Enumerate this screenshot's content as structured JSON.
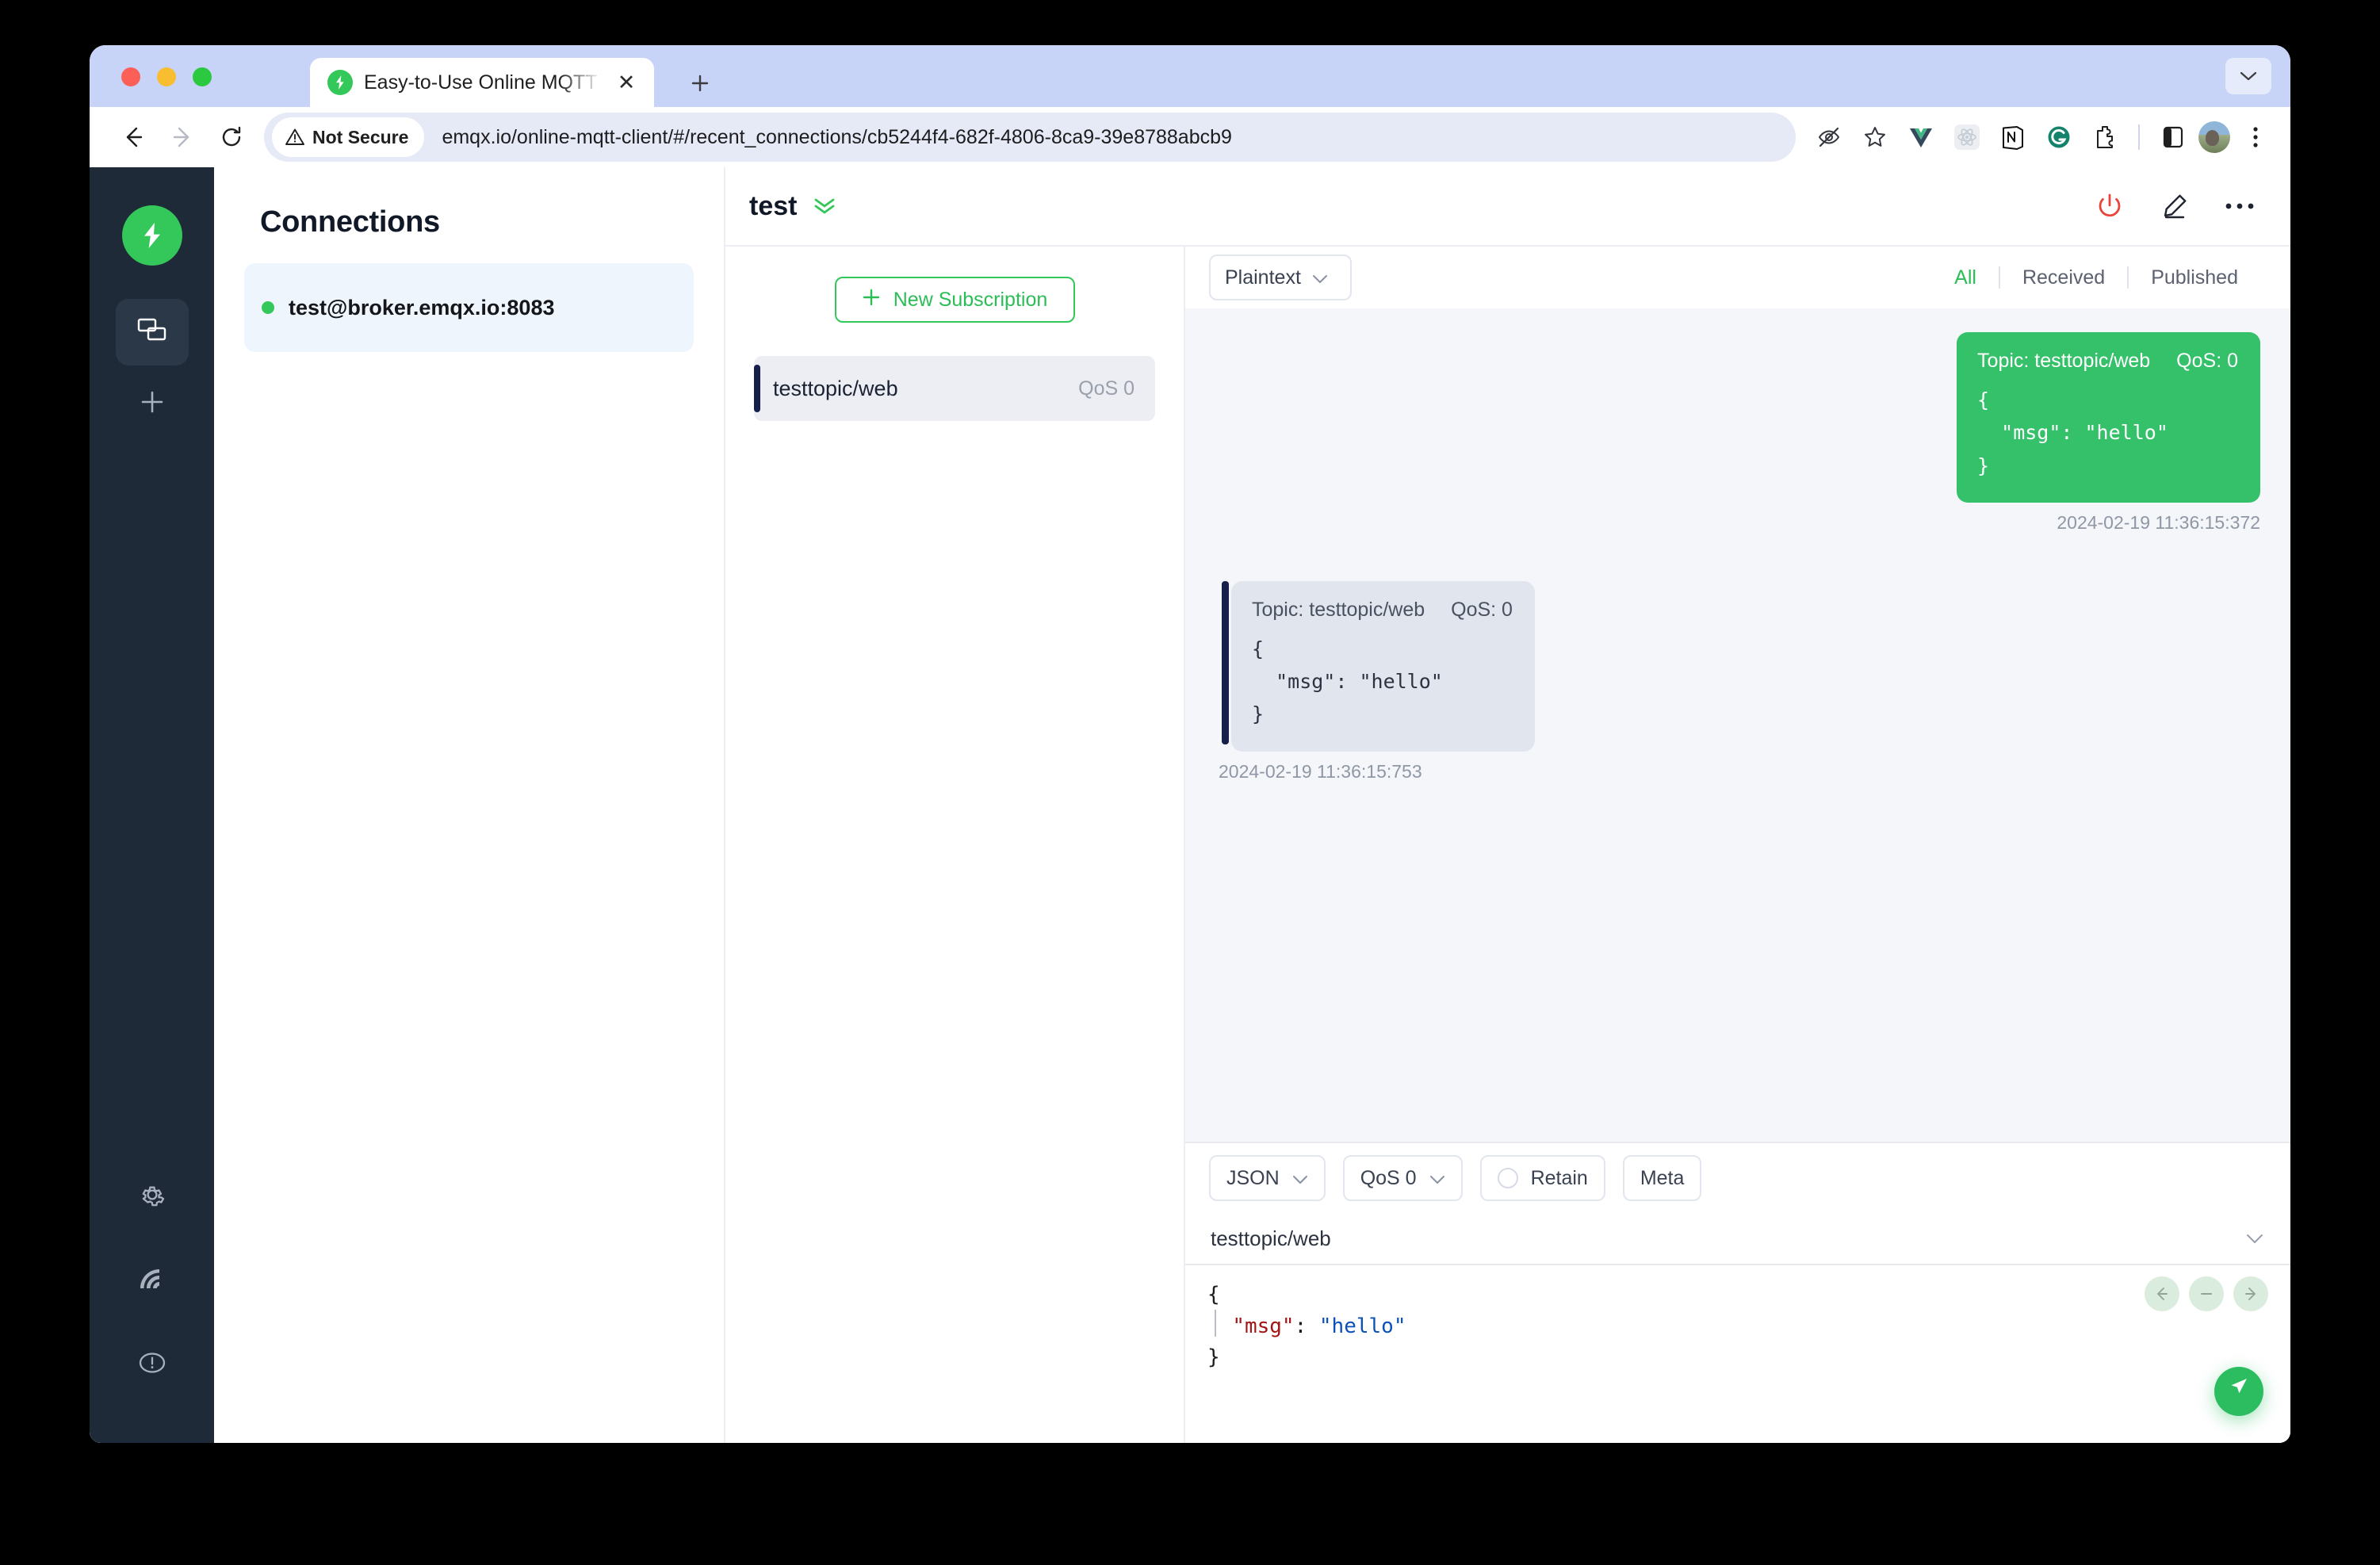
{
  "browser": {
    "tab": {
      "title": "Easy-to-Use Online MQTT Cli",
      "favicon_icon": "emqx-logo-icon",
      "close_icon": "close-icon"
    },
    "new_tab_icon": "plus-icon",
    "tab_list_icon": "chevron-down-icon",
    "nav": {
      "back_icon": "back-arrow-icon",
      "forward_icon": "forward-arrow-icon",
      "reload_icon": "reload-icon"
    },
    "omnibox": {
      "security_label": "Not Secure",
      "security_icon": "warning-triangle-icon",
      "url": "emqx.io/online-mqtt-client/#/recent_connections/cb5244f4-682f-4806-8ca9-39e8788abcb9"
    },
    "toolbar_icons": [
      "eye-off-icon",
      "bookmark-star-icon",
      "vue-devtools-icon",
      "react-devtools-icon",
      "notion-icon",
      "grammarly-icon",
      "extensions-puzzle-icon",
      "side-panel-icon"
    ],
    "avatar_icon": "profile-avatar",
    "menu_icon": "three-dot-menu-icon"
  },
  "rail": {
    "logo_icon": "emqx-logo-icon",
    "items": [
      {
        "name": "connections",
        "icon": "windows-stack-icon",
        "active": true
      },
      {
        "name": "new-connection",
        "icon": "plus-icon",
        "active": false
      }
    ],
    "bottom_items": [
      {
        "name": "settings",
        "icon": "gear-icon"
      },
      {
        "name": "broadcast",
        "icon": "signal-waves-icon"
      },
      {
        "name": "about",
        "icon": "info-circle-icon"
      }
    ]
  },
  "connections": {
    "title": "Connections",
    "items": [
      {
        "label": "test@broker.emqx.io:8083",
        "status": "connected"
      }
    ]
  },
  "header": {
    "connection_name": "test",
    "expand_icon": "double-chevron-down-icon",
    "actions": [
      {
        "name": "disconnect",
        "icon": "power-icon"
      },
      {
        "name": "edit",
        "icon": "pencil-icon"
      },
      {
        "name": "more",
        "icon": "three-dot-menu-icon"
      }
    ]
  },
  "subscriptions": {
    "new_button_label": "New Subscription",
    "new_button_icon": "plus-icon",
    "items": [
      {
        "topic": "testtopic/web",
        "qos": "QoS 0"
      }
    ]
  },
  "messages": {
    "format_select": {
      "value": "Plaintext",
      "icon": "chevron-down-icon"
    },
    "filters": [
      {
        "label": "All",
        "active": true
      },
      {
        "label": "Received",
        "active": false
      },
      {
        "label": "Published",
        "active": false
      }
    ],
    "items": [
      {
        "direction": "published",
        "topic_label": "Topic: testtopic/web",
        "qos_label": "QoS: 0",
        "payload": "{\n  \"msg\": \"hello\"\n}",
        "timestamp": "2024-02-19 11:36:15:372"
      },
      {
        "direction": "received",
        "topic_label": "Topic: testtopic/web",
        "qos_label": "QoS: 0",
        "payload": "{\n  \"msg\": \"hello\"\n}",
        "timestamp": "2024-02-19 11:36:15:753"
      }
    ]
  },
  "publisher": {
    "payload_format": {
      "value": "JSON",
      "icon": "chevron-down-icon"
    },
    "qos": {
      "value": "QoS 0",
      "icon": "chevron-down-icon"
    },
    "retain_label": "Retain",
    "retain_checked": false,
    "meta_label": "Meta",
    "topic_value": "testtopic/web",
    "topic_chevron_icon": "chevron-down-icon",
    "editor": {
      "line1": "{",
      "key": "\"msg\"",
      "colon": ": ",
      "value": "\"hello\"",
      "line3": "}"
    },
    "nav_icons": [
      "arrow-left-icon",
      "minus-icon",
      "arrow-right-icon"
    ],
    "send_icon": "send-paper-plane-icon"
  },
  "colors": {
    "brand_green": "#34c759",
    "published_bubble": "#34c16a",
    "received_bubble": "#e1e5ed",
    "accent_dark": "#16204a",
    "disconnect_red": "#e8443c",
    "rail_bg": "#1e2a38"
  }
}
